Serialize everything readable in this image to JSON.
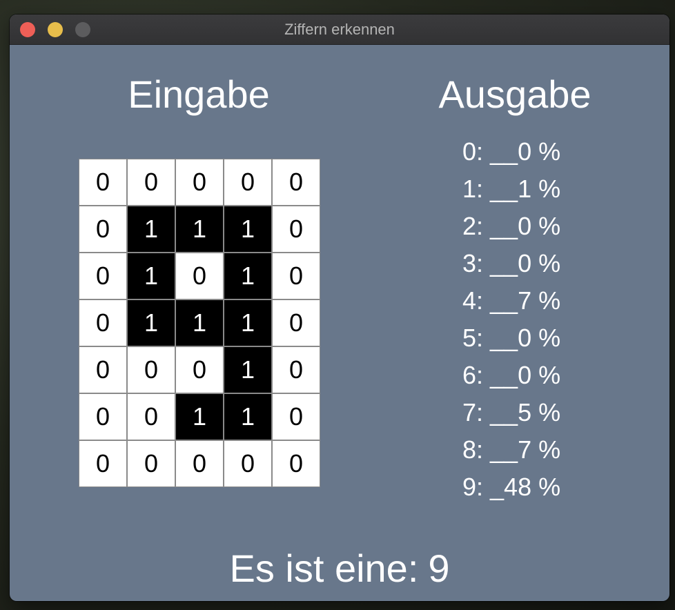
{
  "window": {
    "title": "Ziffern erkennen"
  },
  "headings": {
    "input": "Eingabe",
    "output": "Ausgabe"
  },
  "grid": {
    "rows": [
      [
        "0",
        "0",
        "0",
        "0",
        "0"
      ],
      [
        "0",
        "1",
        "1",
        "1",
        "0"
      ],
      [
        "0",
        "1",
        "0",
        "1",
        "0"
      ],
      [
        "0",
        "1",
        "1",
        "1",
        "0"
      ],
      [
        "0",
        "0",
        "0",
        "1",
        "0"
      ],
      [
        "0",
        "0",
        "1",
        "1",
        "0"
      ],
      [
        "0",
        "0",
        "0",
        "0",
        "0"
      ]
    ]
  },
  "probabilities": [
    "0: __0 %",
    "1: __1 %",
    "2: __0 %",
    "3: __0 %",
    "4: __7 %",
    "5: __0 %",
    "6: __0 %",
    "7: __5 %",
    "8: __7 %",
    "9: _48 %"
  ],
  "result": {
    "label": "Es ist eine:",
    "value": "9"
  },
  "colors": {
    "window_background": "#68778b",
    "cell_on": "#000000",
    "cell_off": "#ffffff",
    "close_button": "#ee5f57",
    "minimize_button": "#e7bd4b",
    "zoom_button": "#5c5c5e"
  }
}
